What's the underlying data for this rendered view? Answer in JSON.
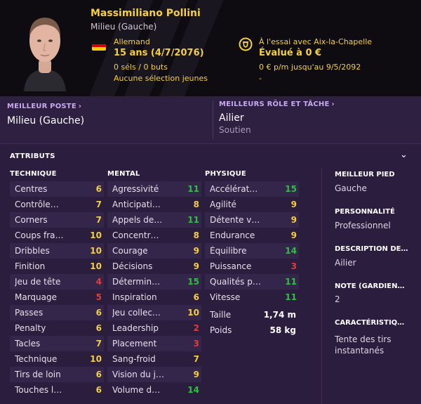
{
  "header": {
    "name": "Massimiliano Pollini",
    "position": "Milieu (Gauche)",
    "nationality": "Allemand",
    "age": "15 ans (4/7/2076)",
    "caps": "0 séls / 0 buts",
    "youth_caps": "Aucune sélection jeunes",
    "loan_status": "À l'essai avec Aix-la-Chapelle",
    "value": "Évalué à 0 €",
    "wage": "0 € p/m jusqu'au 9/5/2092",
    "extra": "-",
    "flag_colors": [
      "#111111",
      "#dd0000",
      "#ffce00"
    ],
    "badge_colors": {
      "outer": "#f4d03f",
      "inner": "#111111"
    }
  },
  "best_position": {
    "label": "MEILLEUR POSTE",
    "value": "Milieu (Gauche)"
  },
  "best_role": {
    "label": "MEILLEURS RÔLE ET TÂCHE",
    "value": "Ailier",
    "duty": "Soutien"
  },
  "attributes": {
    "title": "ATTRIBUTS",
    "colors": {
      "high": "#2fc043",
      "medium": "#f4d03f",
      "low": "#e23c3c"
    },
    "technique": {
      "heading": "TECHNIQUE",
      "items": [
        {
          "label": "Centres",
          "value": "6",
          "tier": "medium"
        },
        {
          "label": "Contrôle…",
          "value": "7",
          "tier": "medium"
        },
        {
          "label": "Corners",
          "value": "7",
          "tier": "medium"
        },
        {
          "label": "Coups fra…",
          "value": "10",
          "tier": "medium"
        },
        {
          "label": "Dribbles",
          "value": "10",
          "tier": "medium"
        },
        {
          "label": "Finition",
          "value": "10",
          "tier": "medium"
        },
        {
          "label": "Jeu de tête",
          "value": "4",
          "tier": "low"
        },
        {
          "label": "Marquage",
          "value": "5",
          "tier": "low"
        },
        {
          "label": "Passes",
          "value": "6",
          "tier": "medium"
        },
        {
          "label": "Penalty",
          "value": "6",
          "tier": "medium"
        },
        {
          "label": "Tacles",
          "value": "7",
          "tier": "medium"
        },
        {
          "label": "Technique",
          "value": "10",
          "tier": "medium"
        },
        {
          "label": "Tirs de loin",
          "value": "6",
          "tier": "medium"
        },
        {
          "label": "Touches l…",
          "value": "6",
          "tier": "medium"
        }
      ]
    },
    "mental": {
      "heading": "MENTAL",
      "items": [
        {
          "label": "Agressivité",
          "value": "11",
          "tier": "high"
        },
        {
          "label": "Anticipati…",
          "value": "8",
          "tier": "medium"
        },
        {
          "label": "Appels de…",
          "value": "11",
          "tier": "high"
        },
        {
          "label": "Concentr…",
          "value": "8",
          "tier": "medium"
        },
        {
          "label": "Courage",
          "value": "9",
          "tier": "medium"
        },
        {
          "label": "Décisions",
          "value": "9",
          "tier": "medium"
        },
        {
          "label": "Détermin…",
          "value": "15",
          "tier": "high"
        },
        {
          "label": "Inspiration",
          "value": "6",
          "tier": "medium"
        },
        {
          "label": "Jeu collec…",
          "value": "10",
          "tier": "medium"
        },
        {
          "label": "Leadership",
          "value": "2",
          "tier": "low"
        },
        {
          "label": "Placement",
          "value": "3",
          "tier": "low"
        },
        {
          "label": "Sang-froid",
          "value": "7",
          "tier": "medium"
        },
        {
          "label": "Vision du j…",
          "value": "9",
          "tier": "medium"
        },
        {
          "label": "Volume d…",
          "value": "14",
          "tier": "high"
        }
      ]
    },
    "physique": {
      "heading": "PHYSIQUE",
      "items": [
        {
          "label": "Accélérat…",
          "value": "15",
          "tier": "high"
        },
        {
          "label": "Agilité",
          "value": "9",
          "tier": "medium"
        },
        {
          "label": "Détente v…",
          "value": "9",
          "tier": "medium"
        },
        {
          "label": "Endurance",
          "value": "9",
          "tier": "medium"
        },
        {
          "label": "Équilibre",
          "value": "14",
          "tier": "high"
        },
        {
          "label": "Puissance",
          "value": "3",
          "tier": "low"
        },
        {
          "label": "Qualités p…",
          "value": "11",
          "tier": "high"
        },
        {
          "label": "Vitesse",
          "value": "11",
          "tier": "high"
        }
      ],
      "height_label": "Taille",
      "height_value": "1,74 m",
      "weight_label": "Poids",
      "weight_value": "58 kg"
    },
    "side": {
      "best_foot_label": "MEILLEUR PIED",
      "best_foot_value": "Gauche",
      "personality_label": "PERSONNALITÉ",
      "personality_value": "Professionnel",
      "description_label": "DESCRIPTION DE…",
      "description_value": "Ailier",
      "note_label": "NOTE (GARDIEN…",
      "note_value": "2",
      "traits_label": "CARACTÉRISTIQ…",
      "traits_value": "Tente des tirs instantanés"
    }
  }
}
